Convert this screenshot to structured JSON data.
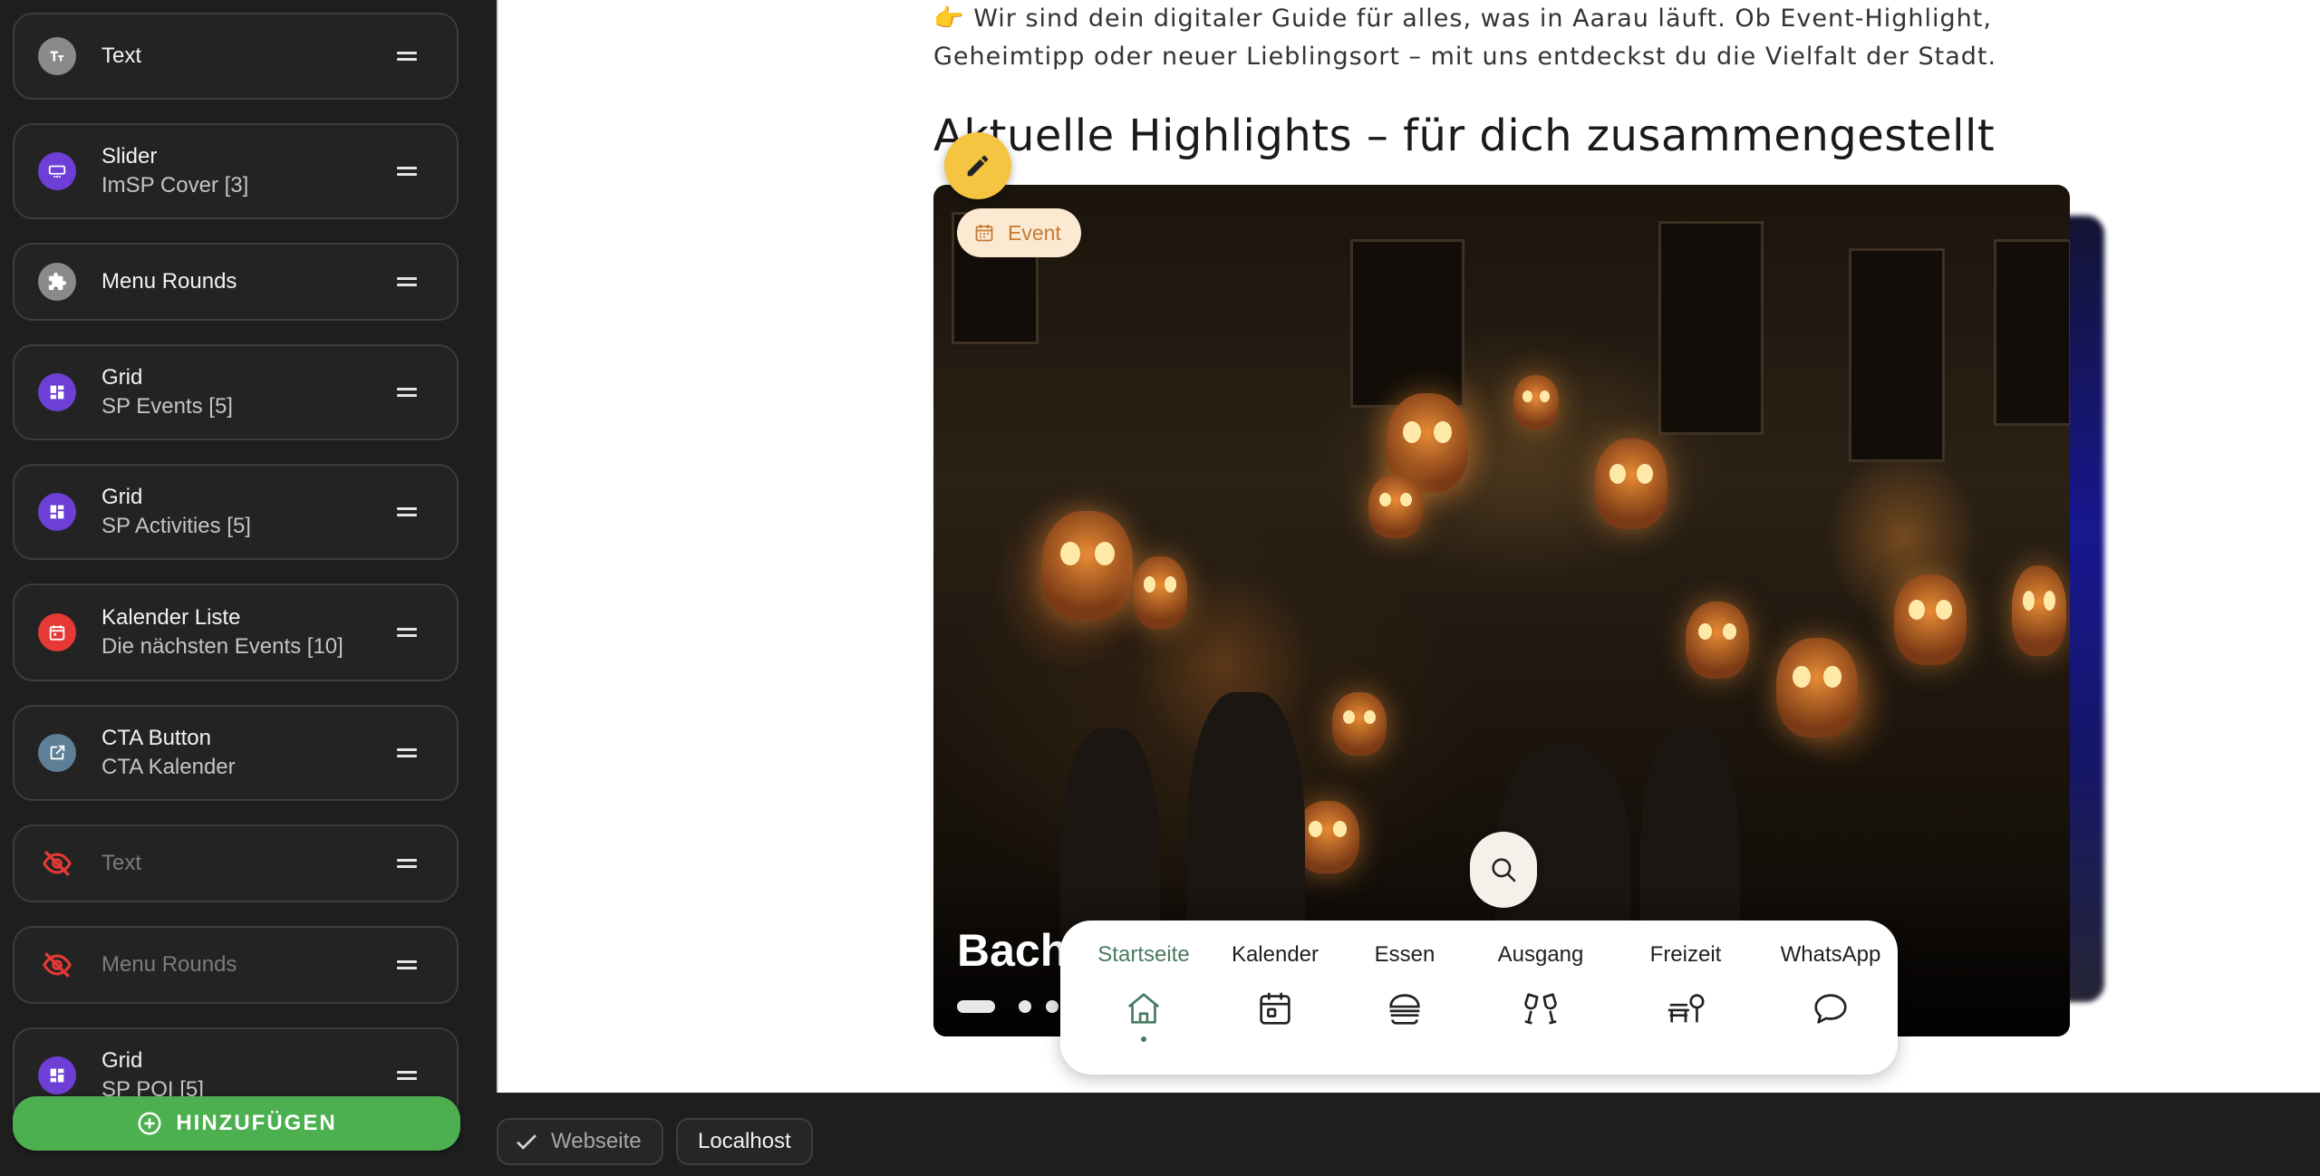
{
  "sidebar": {
    "blocks": [
      {
        "title": "Text",
        "subtitle": "",
        "icon": "text-format-icon",
        "color": "#8a8a8a",
        "hidden": false
      },
      {
        "title": "Slider",
        "subtitle": "ImSP Cover [3]",
        "icon": "slider-icon",
        "color": "#6d3fd6",
        "hidden": false
      },
      {
        "title": "Menu Rounds",
        "subtitle": "",
        "icon": "puzzle-icon",
        "color": "#8a8a8a",
        "hidden": false
      },
      {
        "title": "Grid",
        "subtitle": "SP Events [5]",
        "icon": "dashboard-icon",
        "color": "#6d3fd6",
        "hidden": false
      },
      {
        "title": "Grid",
        "subtitle": "SP Activities [5]",
        "icon": "dashboard-icon",
        "color": "#6d3fd6",
        "hidden": false
      },
      {
        "title": "Kalender Liste",
        "subtitle": "Die nächsten Events [10]",
        "icon": "calendar-icon",
        "color": "#e53935",
        "hidden": false
      },
      {
        "title": "CTA Button",
        "subtitle": "CTA Kalender",
        "icon": "open-in-new-icon",
        "color": "#5f7f97",
        "hidden": false
      },
      {
        "title": "Text",
        "subtitle": "",
        "icon": "eye-off-icon",
        "color": "#e53935",
        "hidden": true
      },
      {
        "title": "Menu Rounds",
        "subtitle": "",
        "icon": "eye-off-icon",
        "color": "#e53935",
        "hidden": true
      },
      {
        "title": "Grid",
        "subtitle": "SP POI [5]",
        "icon": "dashboard-icon",
        "color": "#6d3fd6",
        "hidden": false
      }
    ],
    "add_label": "HINZUFÜGEN"
  },
  "preview": {
    "intro_text": "👉 Wir sind dein digitaler Guide für alles, was in Aarau läuft. Ob Event-Highlight, Geheimtipp oder neuer Lieblingsort – mit uns entdeckst du die Vielfalt der Stadt.",
    "highlights_title": "Aktuelle Highlights – für dich zusammengestellt",
    "hero": {
      "badge": "Event",
      "title_visible": "Bach",
      "slides_count": 3,
      "active_slide": 1
    },
    "bottom_nav": [
      {
        "label": "Startseite",
        "icon": "home-icon",
        "active": true
      },
      {
        "label": "Kalender",
        "icon": "calendar-icon",
        "active": false
      },
      {
        "label": "Essen",
        "icon": "burger-icon",
        "active": false
      },
      {
        "label": "Ausgang",
        "icon": "cheers-icon",
        "active": false
      },
      {
        "label": "Freizeit",
        "icon": "bench-tree-icon",
        "active": false
      },
      {
        "label": "WhatsApp",
        "icon": "chat-bubble-icon",
        "active": false
      }
    ]
  },
  "footer": {
    "website_label": "Webseite",
    "localhost_label": "Localhost"
  },
  "colors": {
    "accent_green": "#4caf50",
    "nav_active": "#4a7a62",
    "edit_fab": "#f5c542",
    "badge_bg": "#fbe9d2",
    "badge_text": "#c57b35"
  }
}
